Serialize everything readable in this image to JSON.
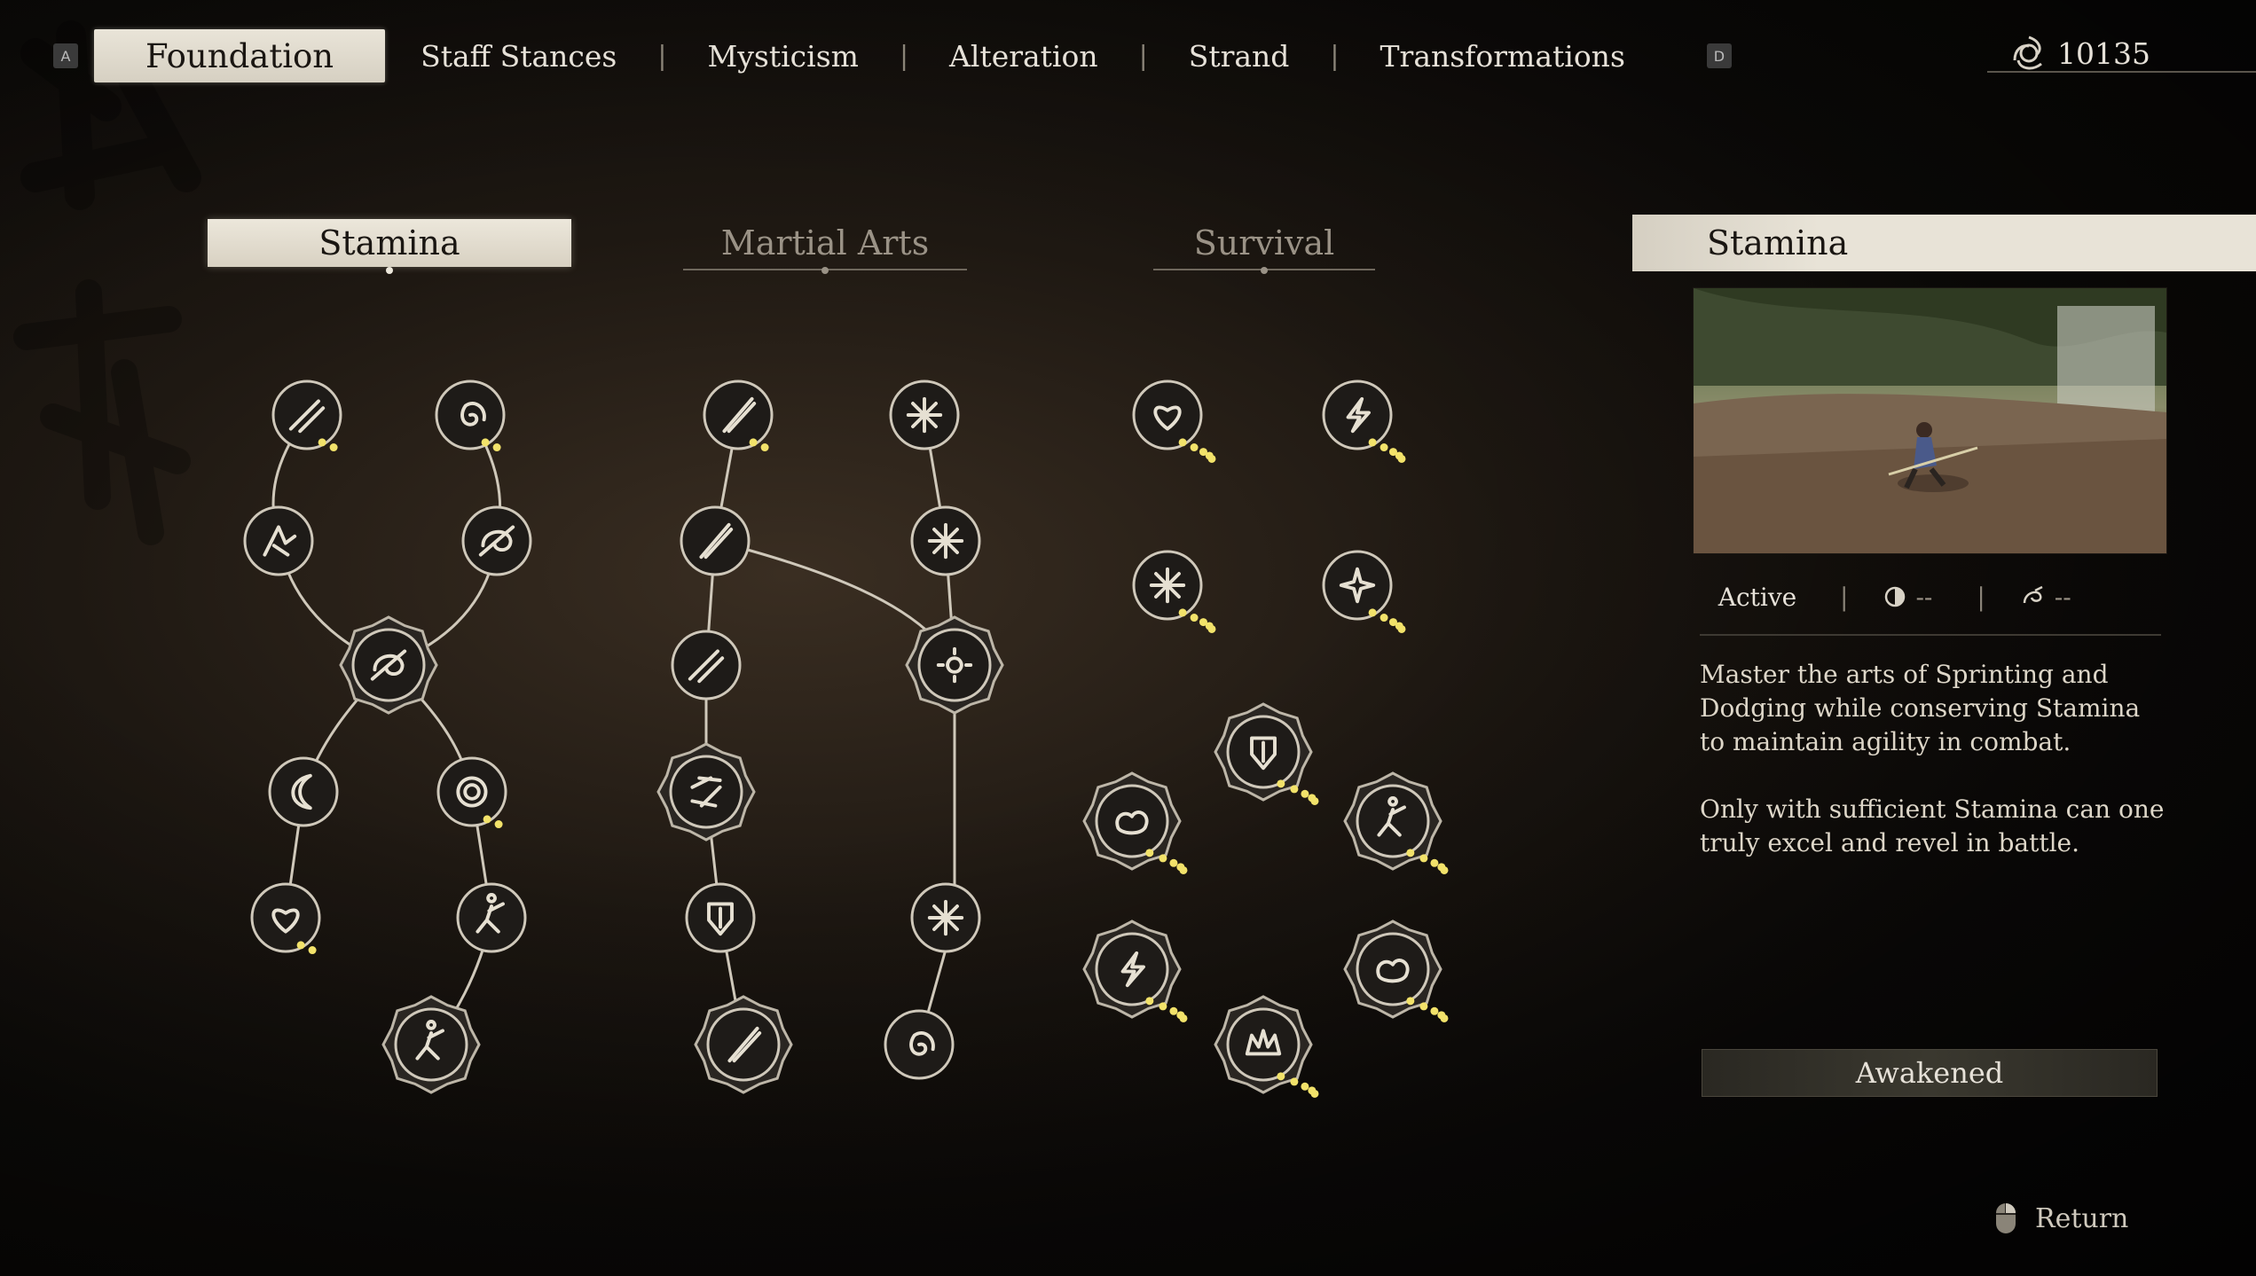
{
  "nav": {
    "left_key": "A",
    "right_key": "D",
    "tabs": [
      "Foundation",
      "Staff Stances",
      "Mysticism",
      "Alteration",
      "Strand",
      "Transformations"
    ],
    "active_tab": "Foundation",
    "currency_icon": "spirit-swirl-icon",
    "currency_value": "10135"
  },
  "categories": {
    "stamina": "Stamina",
    "martial_arts": "Martial Arts",
    "survival": "Survival",
    "active": "Stamina"
  },
  "panel": {
    "title": "Stamina",
    "preview_image": "character-dodging-in-forest",
    "status": "Active",
    "stat1_icon": "moon-phase-icon",
    "stat1_value": "--",
    "stat2_icon": "swirl-cost-icon",
    "stat2_value": "--",
    "description_1": "Master the arts of Sprinting and Dodging while conserving Stamina to maintain agility in combat.",
    "description_2": "Only with sufficient Stamina can one truly excel and revel in battle.",
    "awakened_label": "Awakened"
  },
  "footer": {
    "mouse_icon": "mouse-icon",
    "return_label": "Return"
  },
  "colors": {
    "accent_gold": "#f2e26a",
    "node_fill": "#1e1b18",
    "node_border": "#cfc8ba"
  }
}
